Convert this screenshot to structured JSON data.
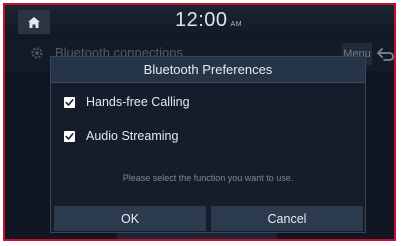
{
  "status": {
    "time": "12:00",
    "ampm": "AM"
  },
  "background": {
    "screen_title": "Bluetooth connections",
    "menu_label": "Menu"
  },
  "dialog": {
    "title": "Bluetooth Preferences",
    "options": [
      {
        "label": "Hands-free Calling",
        "checked": true
      },
      {
        "label": "Audio Streaming",
        "checked": true
      }
    ],
    "hint": "Please select the function you want to use.",
    "ok_label": "OK",
    "cancel_label": "Cancel"
  },
  "icons": [
    "home-icon",
    "gear-icon",
    "back-icon",
    "checkmark-icon"
  ],
  "colors": {
    "screen_bg": "#0d1420",
    "dialog_bg": "#151d2a",
    "title_bar": "#263447",
    "button_bg": "#2c3a4e",
    "frame_border": "#c8102e"
  }
}
